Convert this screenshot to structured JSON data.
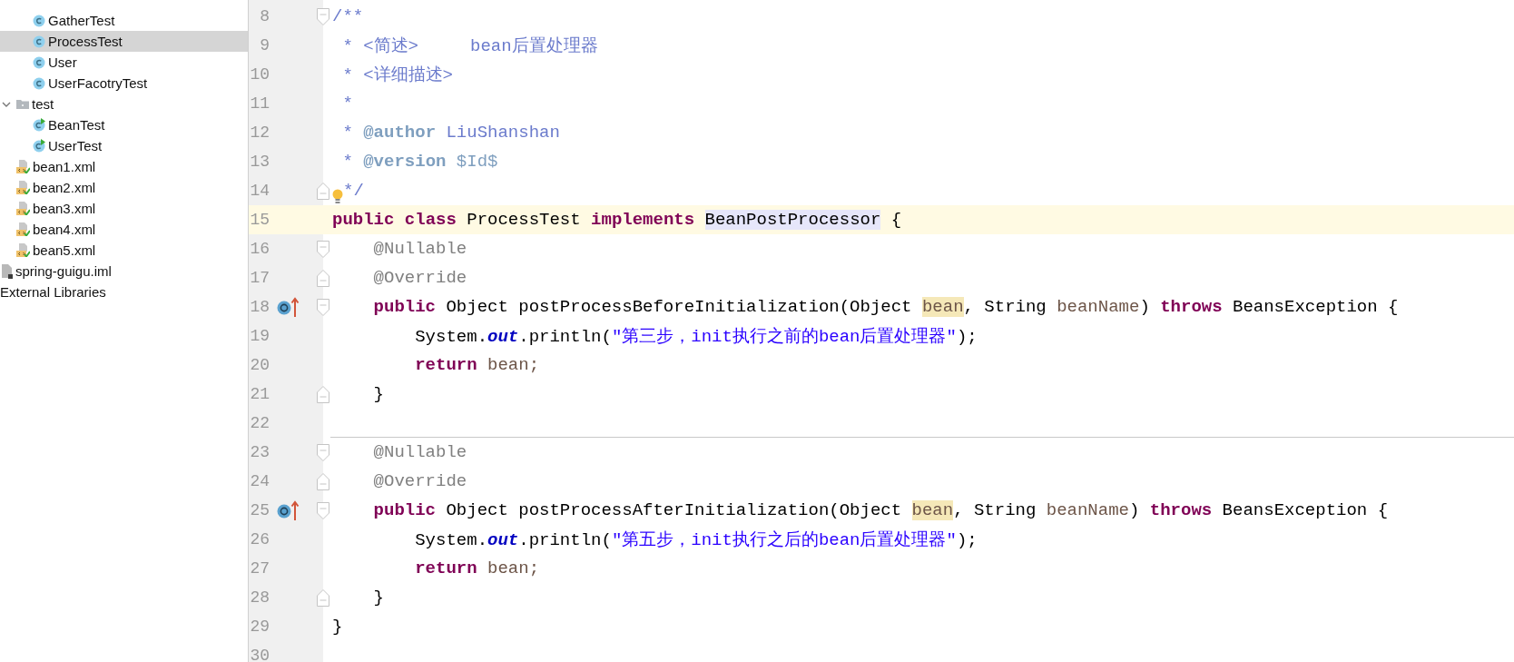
{
  "project_tree": [
    {
      "children": [
        {
          "children": [
            {
              "children": [
                {
                  "label": "GatherTest",
                  "kind": "class",
                  "selected": false
                },
                {
                  "label": "ProcessTest",
                  "kind": "class",
                  "selected": true
                },
                {
                  "label": "User",
                  "kind": "class",
                  "selected": false
                },
                {
                  "label": "UserFacotryTest",
                  "kind": "class",
                  "selected": false
                }
              ]
            },
            {
              "label": "test",
              "kind": "folder",
              "selected": false,
              "expanded": true,
              "children": [
                {
                  "label": "BeanTest",
                  "kind": "test-class",
                  "selected": false
                },
                {
                  "label": "UserTest",
                  "kind": "test-class",
                  "selected": false
                }
              ]
            },
            {
              "label": "bean1.xml",
              "kind": "xml",
              "selected": false
            },
            {
              "label": "bean2.xml",
              "kind": "xml",
              "selected": false
            },
            {
              "label": "bean3.xml",
              "kind": "xml",
              "selected": false
            },
            {
              "label": "bean4.xml",
              "kind": "xml",
              "selected": false
            },
            {
              "label": "bean5.xml",
              "kind": "xml",
              "selected": false
            }
          ]
        },
        {
          "label": "spring-guigu.iml",
          "kind": "iml",
          "selected": false
        }
      ]
    },
    {
      "label": "External Libraries",
      "selected": false
    }
  ],
  "editor": {
    "lines": [
      {
        "number": "8",
        "current": false,
        "markers": [
          {
            "kind": "fold-start"
          }
        ],
        "tokens": [
          {
            "text": "/**",
            "kind": "doc"
          }
        ]
      },
      {
        "number": "9",
        "current": false,
        "tokens": [
          {
            "text": " * <简述>     bean后置处理器",
            "kind": "doc"
          }
        ]
      },
      {
        "number": "10",
        "current": false,
        "tokens": [
          {
            "text": " * <详细描述>",
            "kind": "doc"
          }
        ]
      },
      {
        "number": "11",
        "current": false,
        "tokens": [
          {
            "text": " *",
            "kind": "doc"
          }
        ]
      },
      {
        "number": "12",
        "current": false,
        "tokens": [
          {
            "text": " * ",
            "kind": "doc"
          },
          {
            "text": "@author",
            "kind": "doctag"
          },
          {
            "text": " LiuShanshan",
            "kind": "doc"
          }
        ]
      },
      {
        "number": "13",
        "current": false,
        "tokens": [
          {
            "text": " * ",
            "kind": "doc"
          },
          {
            "text": "@version",
            "kind": "doctag"
          },
          {
            "text": " $Id$",
            "kind": "docvalue"
          }
        ]
      },
      {
        "number": "14",
        "current": false,
        "markers": [
          {
            "kind": "fold-end"
          },
          {
            "kind": "bulb"
          }
        ],
        "tokens": [
          {
            "text": "*/",
            "kind": "doc"
          }
        ]
      },
      {
        "number": "15",
        "current": true,
        "tokens": [
          {
            "text": "public",
            "kind": "keyword"
          },
          {
            "text": " class",
            "kind": "keyword"
          },
          {
            "text": " ProcessTest ",
            "kind": "plain"
          },
          {
            "text": "implements ",
            "kind": "keyword"
          },
          {
            "text": "BeanPostProcessor",
            "kind": "type-highlight"
          },
          {
            "text": " {",
            "kind": "plain"
          }
        ]
      },
      {
        "number": "16",
        "current": false,
        "markers": [
          {
            "kind": "fold-start"
          }
        ],
        "tokens": [
          {
            "text": "    @Nullable",
            "kind": "annotation"
          }
        ]
      },
      {
        "number": "17",
        "current": false,
        "markers": [
          {
            "kind": "fold-end"
          }
        ],
        "tokens": [
          {
            "text": "    @Override",
            "kind": "annotation"
          }
        ]
      },
      {
        "number": "18",
        "current": false,
        "markers": [
          {
            "kind": "override"
          },
          {
            "kind": "fold-start"
          }
        ],
        "tokens": [
          {
            "text": "    public",
            "kind": "keyword"
          },
          {
            "text": " Object postProcessBeforeInitialization(Object ",
            "kind": "plain"
          },
          {
            "text": "bean",
            "kind": "usage-highlight"
          },
          {
            "text": ", String ",
            "kind": "plain"
          },
          {
            "text": "beanName",
            "kind": "param"
          },
          {
            "text": ") ",
            "kind": "plain"
          },
          {
            "text": "throws",
            "kind": "keyword"
          },
          {
            "text": " BeansException {",
            "kind": "plain"
          }
        ]
      },
      {
        "number": "19",
        "current": false,
        "tokens": [
          {
            "text": "        System.",
            "kind": "plain"
          },
          {
            "text": "out",
            "kind": "static"
          },
          {
            "text": ".println(",
            "kind": "plain"
          },
          {
            "text": "\"第三步，init执行之前的bean后置处理器\"",
            "kind": "string"
          },
          {
            "text": ");",
            "kind": "plain"
          }
        ]
      },
      {
        "number": "20",
        "current": false,
        "tokens": [
          {
            "text": "        return",
            "kind": "keyword"
          },
          {
            "text": " bean;",
            "kind": "param"
          }
        ]
      },
      {
        "number": "21",
        "current": false,
        "markers": [
          {
            "kind": "fold-end"
          }
        ],
        "tokens": [
          {
            "text": "    }",
            "kind": "plain"
          }
        ]
      },
      {
        "number": "22",
        "current": false,
        "separator_after": true
      },
      {
        "number": "23",
        "current": false,
        "markers": [
          {
            "kind": "fold-start"
          }
        ],
        "tokens": [
          {
            "text": "    @Nullable",
            "kind": "annotation"
          }
        ]
      },
      {
        "number": "24",
        "current": false,
        "markers": [
          {
            "kind": "fold-end"
          }
        ],
        "tokens": [
          {
            "text": "    @Override",
            "kind": "annotation"
          }
        ]
      },
      {
        "number": "25",
        "current": false,
        "markers": [
          {
            "kind": "override"
          },
          {
            "kind": "fold-start"
          }
        ],
        "tokens": [
          {
            "text": "    public",
            "kind": "keyword"
          },
          {
            "text": " Object postProcessAfterInitialization(Object ",
            "kind": "plain"
          },
          {
            "text": "bean",
            "kind": "usage-highlight"
          },
          {
            "text": ", String ",
            "kind": "plain"
          },
          {
            "text": "beanName",
            "kind": "param"
          },
          {
            "text": ") ",
            "kind": "plain"
          },
          {
            "text": "throws",
            "kind": "keyword"
          },
          {
            "text": " BeansException {",
            "kind": "plain"
          }
        ]
      },
      {
        "number": "26",
        "current": false,
        "tokens": [
          {
            "text": "        System.",
            "kind": "plain"
          },
          {
            "text": "out",
            "kind": "static"
          },
          {
            "text": ".println(",
            "kind": "plain"
          },
          {
            "text": "\"第五步，init执行之后的bean后置处理器\"",
            "kind": "string"
          },
          {
            "text": ");",
            "kind": "plain"
          }
        ]
      },
      {
        "number": "27",
        "current": false,
        "tokens": [
          {
            "text": "        return",
            "kind": "keyword"
          },
          {
            "text": " bean;",
            "kind": "param"
          }
        ]
      },
      {
        "number": "28",
        "current": false,
        "markers": [
          {
            "kind": "fold-end"
          }
        ],
        "tokens": [
          {
            "text": "    }",
            "kind": "plain"
          }
        ]
      },
      {
        "number": "29",
        "current": false,
        "tokens": [
          {
            "text": "}",
            "kind": "plain"
          }
        ]
      },
      {
        "number": "30",
        "current": false
      }
    ]
  }
}
